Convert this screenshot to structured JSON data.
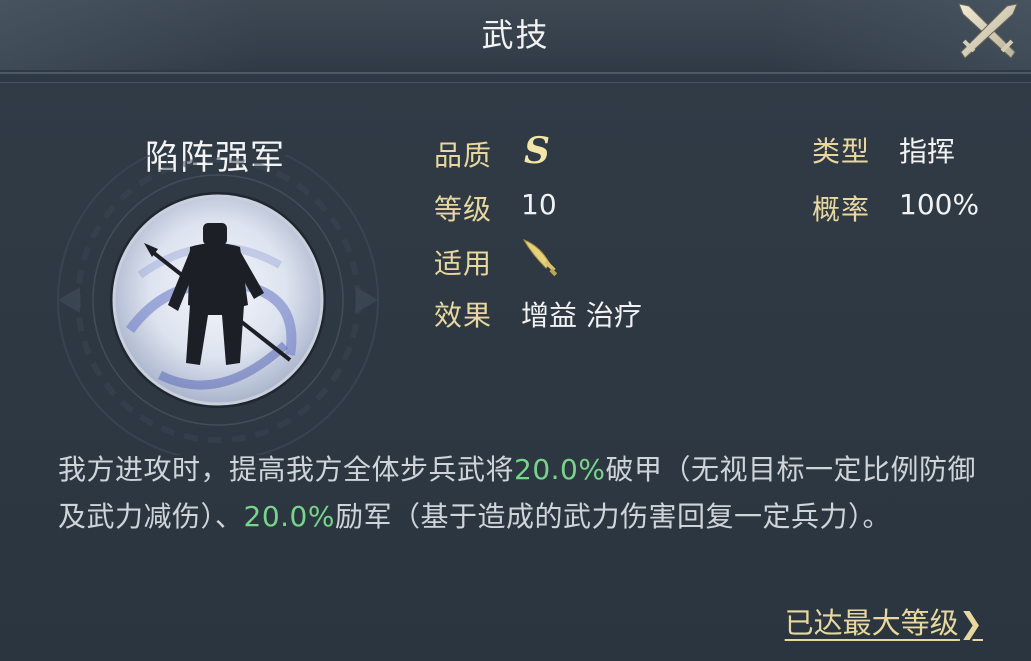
{
  "header": {
    "title": "武技",
    "close_icon": "close-crossed-swords-icon"
  },
  "skill": {
    "name": "陷阵强军",
    "portrait_icon": "armored-spearman-portrait",
    "quality_label": "品质",
    "quality_value": "S",
    "level_label": "等级",
    "level_value": "10",
    "applies_label": "适用",
    "applies_icon": "sword-icon",
    "effect_label": "效果",
    "effect_value": "增益 治疗",
    "type_label": "类型",
    "type_value": "指挥",
    "chance_label": "概率",
    "chance_value": "100%"
  },
  "description": {
    "part1": "我方进攻时，提高我方全体步兵武将",
    "value1": "20.0%",
    "part2": "破甲（无视目标一定比例防御及武力减伤）、",
    "value2": "20.0%",
    "part3": "励军（基于造成的武力伤害回复一定兵力）。"
  },
  "footer": {
    "max_level_label": "已达最大等级",
    "arrow": "❯"
  },
  "colors": {
    "label_gold": "#e8d79e",
    "highlight_green": "#77d48a",
    "background": "#2b353f"
  }
}
